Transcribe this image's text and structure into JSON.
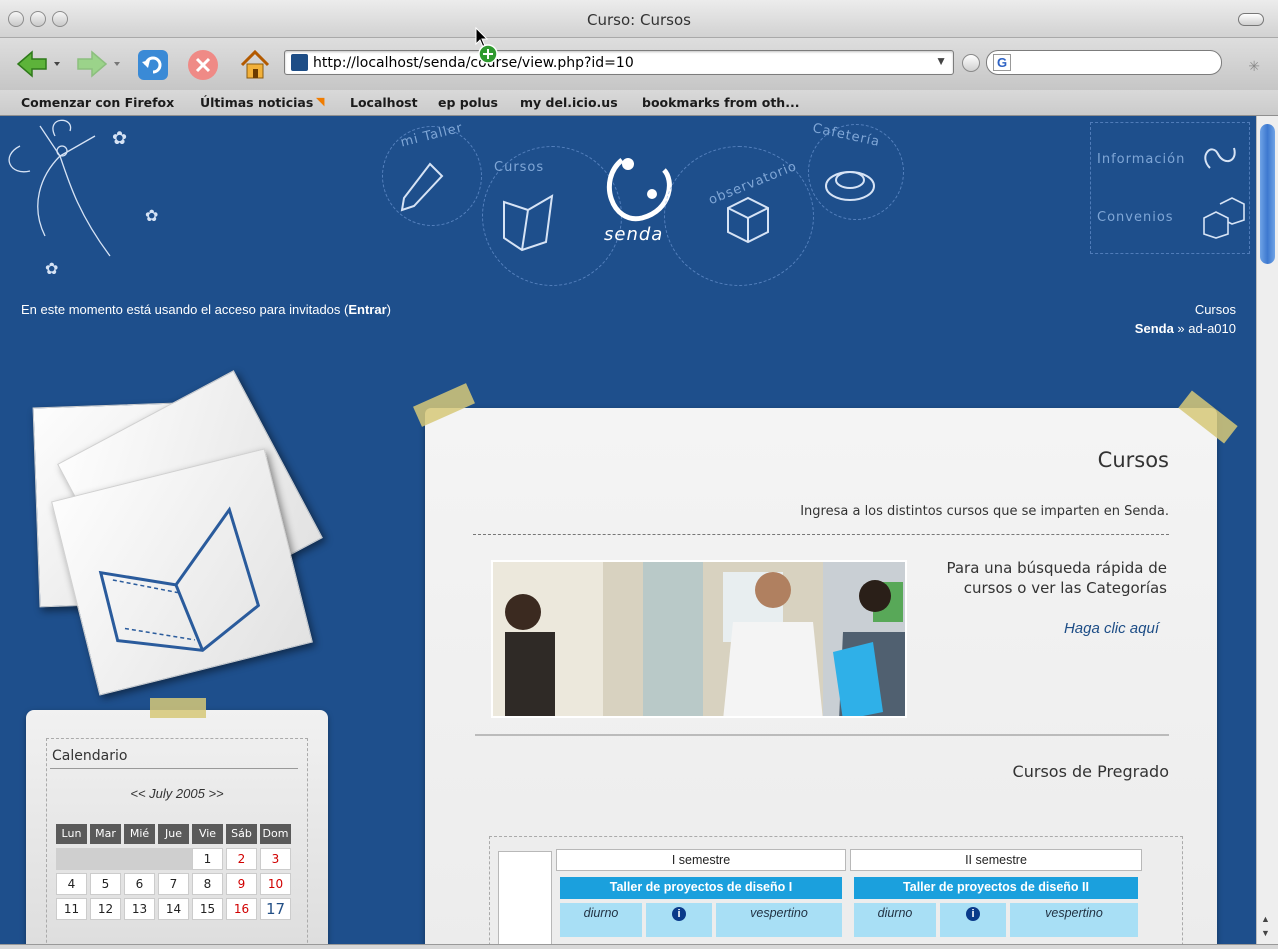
{
  "window": {
    "title": "Curso: Cursos"
  },
  "toolbar": {
    "url": "http://localhost/senda/course/view.php?id=10",
    "search_engine": "G"
  },
  "bookmarks": [
    "Comenzar con Firefox",
    "Últimas noticias",
    "Localhost",
    "ep polus",
    "my del.icio.us",
    "bookmarks from oth..."
  ],
  "site": {
    "nav": {
      "mi_taller": "mi Taller",
      "cursos": "Cursos",
      "logo": "senda",
      "observatorio": "observatorio",
      "cafeteria": "Cafetería"
    },
    "side_links": {
      "informacion": "Información",
      "convenios": "Convenios"
    },
    "guest_text": "En este momento está usando el acceso para invitados (",
    "guest_link": "Entrar",
    "guest_close": ")",
    "breadcrumb": {
      "top": "Cursos",
      "home": "Senda",
      "sep": " » ",
      "current": "ad-a010"
    }
  },
  "main": {
    "title": "Cursos",
    "subtitle": "Ingresa a los distintos cursos que se imparten en Senda.",
    "quick_search_line1": "Para una búsqueda rápida de",
    "quick_search_line2": "cursos o ver las Categorías",
    "quick_link": "Haga clic aquí",
    "section": "Cursos de Pregrado",
    "table": {
      "semesters": [
        "I semestre",
        "II semestre"
      ],
      "courses": [
        "Taller de proyectos de diseño I",
        "Taller de proyectos de diseño II"
      ],
      "turns": [
        "diurno",
        "vespertino"
      ],
      "info_icon": "info-icon"
    }
  },
  "calendar": {
    "title": "Calendario",
    "prev": "<<",
    "month": "July 2005",
    "next": ">>",
    "headers": [
      "Lun",
      "Mar",
      "Mié",
      "Jue",
      "Vie",
      "Sáb",
      "Dom"
    ],
    "weeks": [
      [
        "",
        "",
        "",
        "",
        "1",
        "2",
        "3"
      ],
      [
        "4",
        "5",
        "6",
        "7",
        "8",
        "9",
        "10"
      ],
      [
        "11",
        "12",
        "13",
        "14",
        "15",
        "16",
        "17"
      ]
    ],
    "weekend_color": "#d10000",
    "today": "17"
  },
  "colors": {
    "page_bg": "#1e4f8c",
    "accent_blue": "#1ba0dd",
    "light_blue": "#a8dff5"
  }
}
